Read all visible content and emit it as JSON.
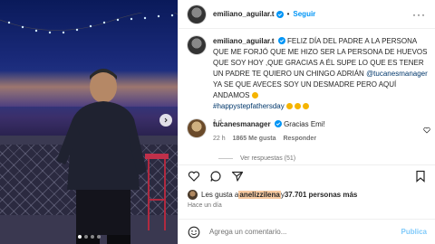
{
  "post": {
    "author": "emiliano_aguilar.t",
    "follow_label": "Seguir",
    "dot": "•",
    "more_label": "···"
  },
  "caption": {
    "author": "emiliano_aguilar.t",
    "text_part1": "FELIZ DÍA DEL PADRE A LA PERSONA QUE ME FORJÓ QUE ME HIZO SER LA PERSONA DE HUEVOS QUE SOY HOY ,QUE GRACIAS A ÉL SUPE LO QUE ES TENER UN PADRE TE QUIERO UN CHINGO ADRIÁN ",
    "mention": "@tucanesmanager",
    "text_part2": " YA SE QUE AVECES SOY UN DESMADRE PERO AQUÍ ANDAMOS ",
    "hashtag": "#happystepfathersday",
    "time": "1 d"
  },
  "comment": {
    "author": "tucanesmanager",
    "text": "Gracias Emi!",
    "time": "22 h",
    "likes": "1865 Me gusta",
    "reply": "Responder"
  },
  "replies": {
    "label": "Ver respuestas (51)"
  },
  "likes": {
    "prefix": "Les gusta a ",
    "user": "anelizzilena",
    "suffix_and": " y ",
    "count": "37.701 personas más"
  },
  "time_ago": "Hace un día",
  "composer": {
    "placeholder": "Agrega un comentario...",
    "publish_label": "Publica"
  }
}
